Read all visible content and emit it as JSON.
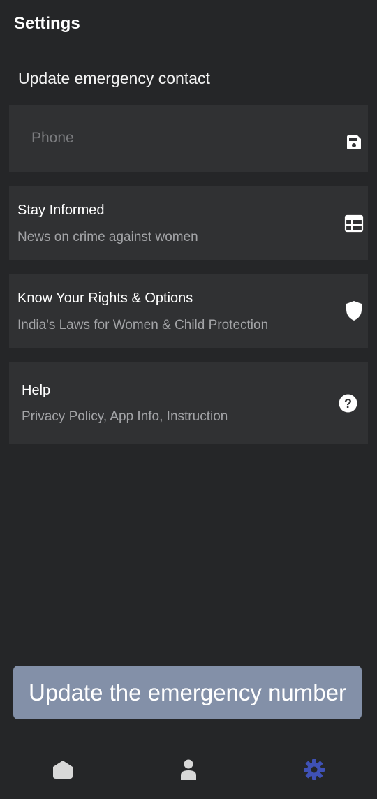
{
  "app": {
    "title": "Settings"
  },
  "emergency": {
    "section_title": "Update emergency contact",
    "phone_placeholder": "Phone",
    "phone_value": "",
    "save_icon": "save-icon"
  },
  "items": [
    {
      "title": "Stay Informed",
      "subtitle": "News on crime against women",
      "icon": "newspaper-icon"
    },
    {
      "title": "Know Your Rights & Options",
      "subtitle": "India's Laws for Women & Child Protection",
      "icon": "shield-icon"
    },
    {
      "title": "Help",
      "subtitle": "Privacy Policy, App Info, Instruction",
      "icon": "help-icon"
    }
  ],
  "toast": {
    "message": "Update the emergency number"
  },
  "nav": {
    "items": [
      {
        "name": "home",
        "icon": "home-icon",
        "active": false
      },
      {
        "name": "profile",
        "icon": "person-icon",
        "active": false
      },
      {
        "name": "settings",
        "icon": "gear-icon",
        "active": true
      }
    ],
    "active_color": "#3f51b5",
    "inactive_color": "#d8d8d8"
  },
  "colors": {
    "background": "#252628",
    "card": "#303133",
    "text_primary": "#ffffff",
    "text_secondary": "#a3a4a7",
    "toast_bg": "#8390a8"
  }
}
